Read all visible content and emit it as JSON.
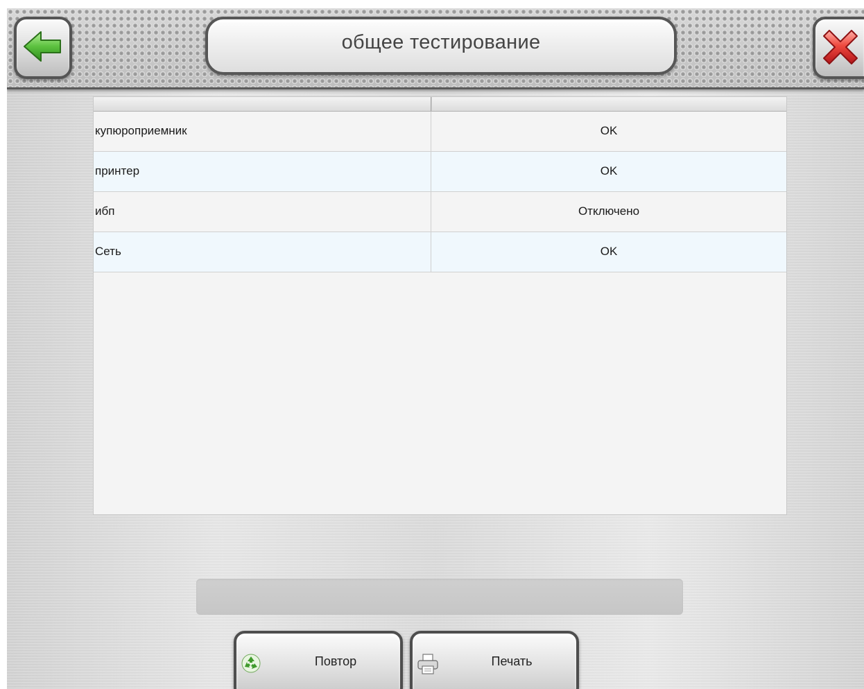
{
  "header": {
    "title": "общее тестирование",
    "back_icon": "arrow-left-icon",
    "close_icon": "close-icon",
    "accent_back": "#5cc13f",
    "accent_close": "#e0312f"
  },
  "table": {
    "columns": [
      "",
      ""
    ],
    "rows": [
      {
        "name": "купюроприемник",
        "status": "OK"
      },
      {
        "name": "принтер",
        "status": "OK"
      },
      {
        "name": "ибп",
        "status": "Отключено"
      },
      {
        "name": "Сеть",
        "status": "OK"
      }
    ],
    "row_colors": [
      "#f4f4f4",
      "#f0f8fd"
    ]
  },
  "status": {
    "message": ""
  },
  "buttons": {
    "repeat": {
      "label": "Повтор",
      "icon": "recycle-icon"
    },
    "print": {
      "label": "Печать",
      "icon": "printer-icon"
    }
  }
}
